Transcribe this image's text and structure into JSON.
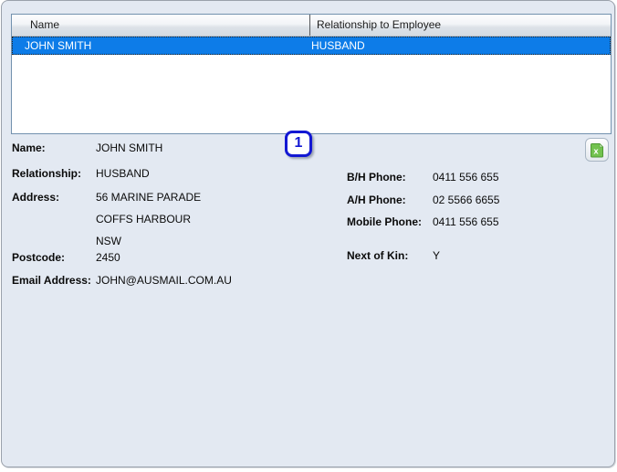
{
  "grid": {
    "columns": [
      {
        "label": "Name"
      },
      {
        "label": "Relationship to Employee"
      }
    ],
    "rows": [
      {
        "name": "JOHN SMITH",
        "relationship": "HUSBAND",
        "selected": true
      }
    ]
  },
  "badge": {
    "value": "1"
  },
  "export_button": {
    "icon": "excel-export-icon"
  },
  "details": {
    "name": {
      "label": "Name:",
      "value": "JOHN SMITH"
    },
    "relationship": {
      "label": "Relationship:",
      "value": "HUSBAND"
    },
    "address": {
      "label": "Address:",
      "lines": [
        "56 MARINE PARADE",
        "COFFS HARBOUR",
        "NSW"
      ]
    },
    "postcode": {
      "label": "Postcode:",
      "value": "2450"
    },
    "email": {
      "label": "Email Address:",
      "value": "JOHN@AUSMAIL.COM.AU"
    },
    "bh_phone": {
      "label": "B/H Phone:",
      "value": "0411 556 655"
    },
    "ah_phone": {
      "label": "A/H Phone:",
      "value": "02 5566 6655"
    },
    "mobile_phone": {
      "label": "Mobile Phone:",
      "value": "0411 556 655"
    },
    "next_of_kin": {
      "label": "Next of Kin:",
      "value": "Y"
    }
  },
  "colors": {
    "panel_background": "#e3e9f2",
    "table_border": "#7291ae",
    "selection_blue": "#0d7ce8",
    "badge_blue": "#1318d3",
    "excel_green": "#72c24e"
  }
}
